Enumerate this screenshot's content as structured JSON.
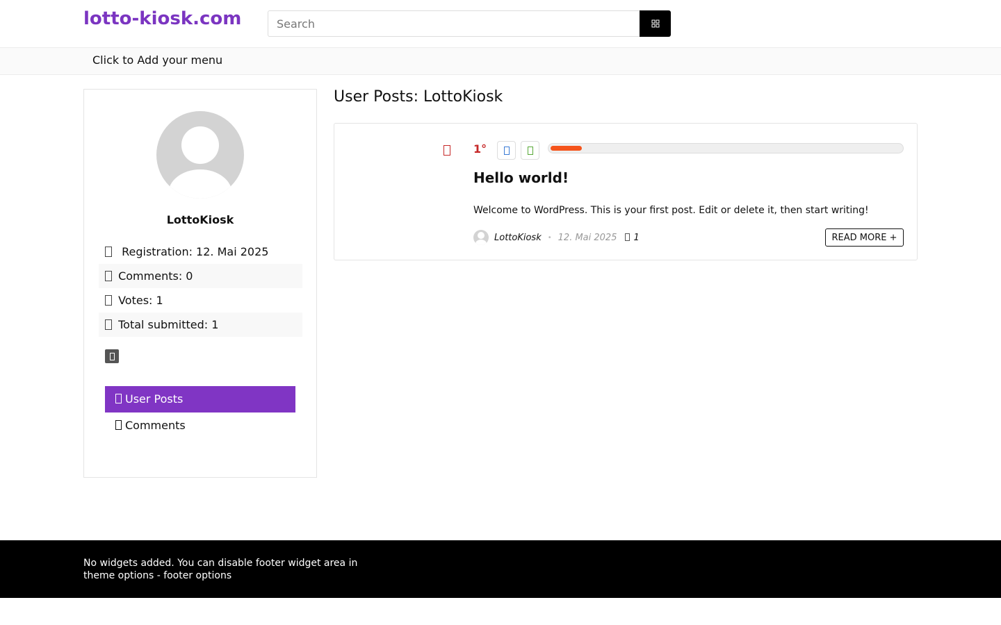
{
  "site": {
    "logo": "lotto-kiosk.com",
    "brand_color": "#7b35c1"
  },
  "search": {
    "placeholder": "Search",
    "button_icon": "grid-search-icon"
  },
  "menu": {
    "label": "Click to Add your menu"
  },
  "profile": {
    "name": "LottoKiosk",
    "stats": [
      {
        "label": "Registration: 12. Mai 2025",
        "icon": "calendar-icon"
      },
      {
        "label": "Comments: 0",
        "icon": "comment-icon"
      },
      {
        "label": "Votes: 1",
        "icon": "vote-icon"
      },
      {
        "label": "Total submitted: 1",
        "icon": "submitted-icon"
      }
    ],
    "rss_icon": "rss-icon",
    "nav": [
      {
        "label": "User Posts",
        "icon": "posts-icon",
        "active": true
      },
      {
        "label": "Comments",
        "icon": "comments-icon",
        "active": false
      }
    ],
    "active_color": "#8035c4"
  },
  "main": {
    "title": "User Posts: LottoKiosk",
    "post": {
      "hot_icon": "fire-icon",
      "score": "1°",
      "vote_up_icon": "thumb-up-icon",
      "vote_down_icon": "thumb-down-icon",
      "progress_percent": 10,
      "progress_color": "#f5541c",
      "title": "Hello world!",
      "excerpt": "Welcome to WordPress. This is your first post. Edit or delete it, then start writing!",
      "author": "LottoKiosk",
      "date": "12. Mai 2025",
      "comments": "1",
      "read_more": "READ MORE +"
    }
  },
  "footer": {
    "text": "No widgets added. You can disable footer widget area in theme options - footer options"
  }
}
